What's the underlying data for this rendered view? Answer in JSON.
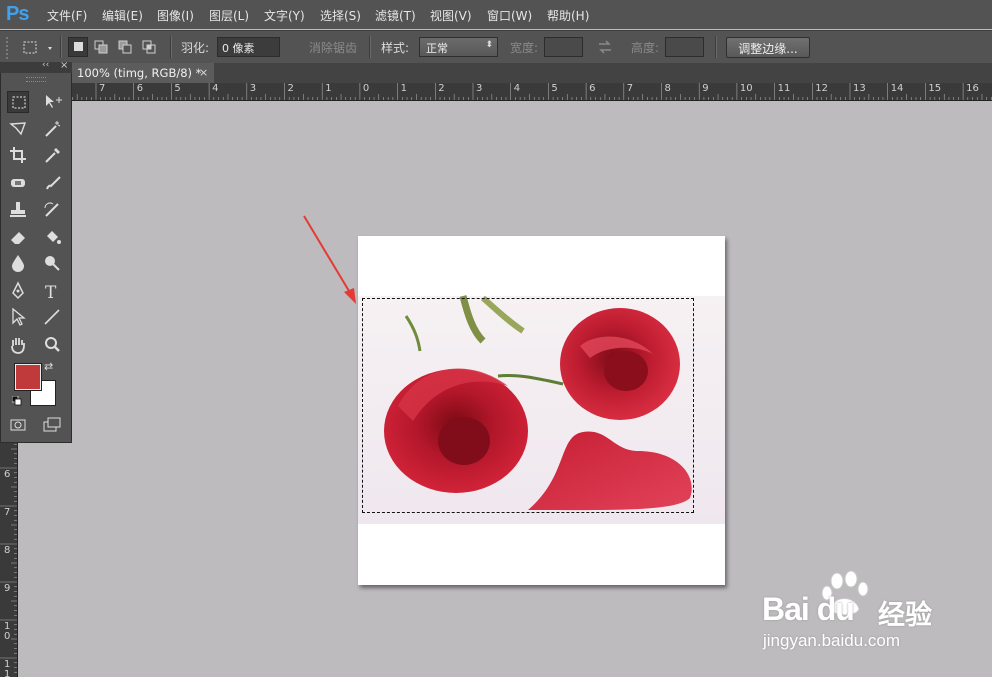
{
  "app": {
    "logo": "Ps"
  },
  "menu": [
    "文件(F)",
    "编辑(E)",
    "图像(I)",
    "图层(L)",
    "文字(Y)",
    "选择(S)",
    "滤镜(T)",
    "视图(V)",
    "窗口(W)",
    "帮助(H)"
  ],
  "options": {
    "feather_label": "羽化:",
    "feather_value": "0 像素",
    "antialias_label": "消除锯齿",
    "style_label": "样式:",
    "style_value": "正常",
    "width_label": "宽度:",
    "height_label": "高度:",
    "refine_edge_button": "调整边缘..."
  },
  "document": {
    "tab_title": "100% (timg, RGB/8) *",
    "close_glyph": "×"
  },
  "ruler_top": [
    "7",
    "6",
    "5",
    "4",
    "3",
    "2",
    "1",
    "0",
    "1",
    "2",
    "3",
    "4",
    "5",
    "6",
    "7",
    "8",
    "9",
    "10",
    "11",
    "12",
    "13",
    "14",
    "15",
    "16"
  ],
  "ruler_left": [
    "6",
    "7",
    "8",
    "9",
    "1\n0",
    "1\n1"
  ],
  "colors": {
    "foreground": "#c0393b",
    "background": "#ffffff",
    "ui_dark": "#535353",
    "canvas_bg": "#bdbbbd",
    "arrow": "#e53935"
  },
  "watermark": {
    "brand": "Bai du",
    "suffix": "经验",
    "url": "jingyan.baidu.com"
  }
}
